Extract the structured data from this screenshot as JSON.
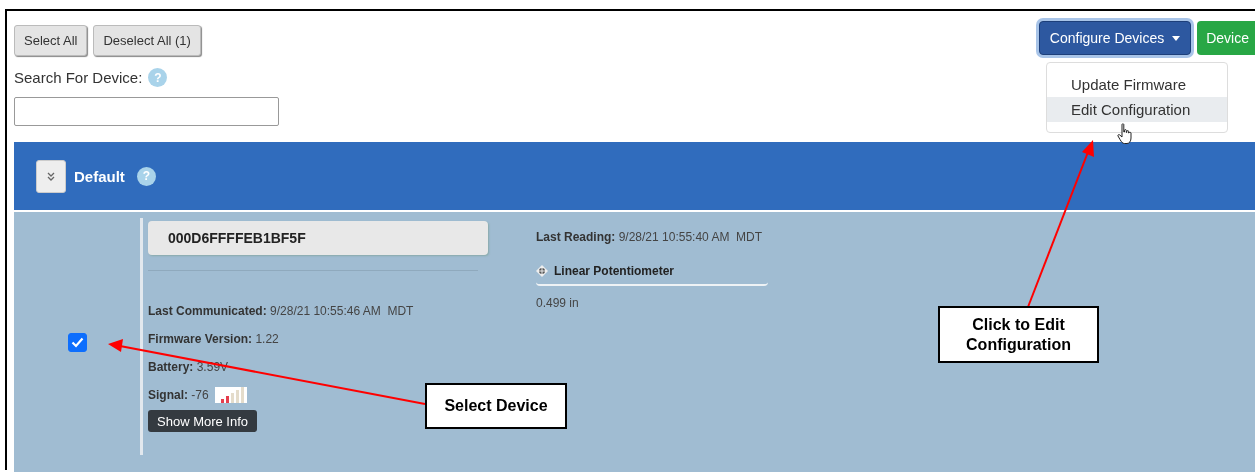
{
  "toolbar": {
    "buttons": [
      {
        "label": "Select All"
      },
      {
        "label": "Deselect All (1)"
      }
    ],
    "configure_button": {
      "label": "Configure Devices",
      "expanded": true
    },
    "device_button": {
      "label": "Device"
    }
  },
  "dropdown": {
    "items": [
      {
        "label": "Update Firmware",
        "selected": false
      },
      {
        "label": "Edit Configuration",
        "selected": true
      }
    ]
  },
  "search": {
    "label": "Search For Device:",
    "help": "?"
  },
  "group": {
    "name": "Default",
    "help": "?"
  },
  "device": {
    "checked": true,
    "id": "000D6FFFFEB1BF5F",
    "details": [
      {
        "label": "Last Communicated:",
        "value": "9/28/21 10:55:46 AM  MDT"
      },
      {
        "label": "Firmware Version:",
        "value": "1.22"
      },
      {
        "label": "Battery:",
        "value": "3.59V"
      },
      {
        "label": "Signal:",
        "value": "-76"
      }
    ],
    "more_button": "Show More Info",
    "last_reading": {
      "label": "Last Reading:",
      "value": "9/28/21 10:55:40 AM  MDT"
    },
    "sensor": {
      "name": "Linear Potentiometer",
      "value": "0.499 in"
    }
  },
  "callouts": [
    {
      "text": "Select Device"
    },
    {
      "text": "Click to Edit Configuration"
    }
  ]
}
